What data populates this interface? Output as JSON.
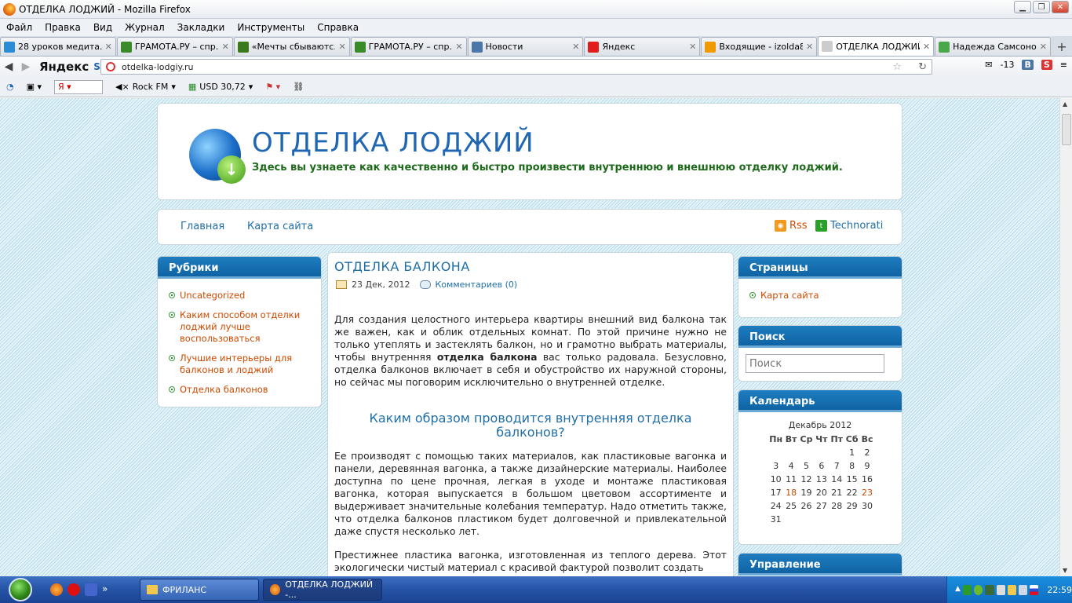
{
  "window": {
    "title": "ОТДЕЛКА ЛОДЖИЙ - Mozilla Firefox"
  },
  "menu": [
    "Файл",
    "Правка",
    "Вид",
    "Журнал",
    "Закладки",
    "Инструменты",
    "Справка"
  ],
  "tabs": [
    {
      "label": "28 уроков медита...",
      "icon": "yandex-icon",
      "color": "#2a8bd6"
    },
    {
      "label": "ГРАМОТА.РУ – спр...",
      "icon": "gramota-icon",
      "color": "#3a8a2a"
    },
    {
      "label": "«Мечты сбываютс...",
      "icon": "game-icon",
      "color": "#3a7a1a"
    },
    {
      "label": "ГРАМОТА.РУ – спр...",
      "icon": "gramota-icon",
      "color": "#3a8a2a"
    },
    {
      "label": "Новости",
      "icon": "vk-icon",
      "color": "#4a76a8"
    },
    {
      "label": "Яндекс",
      "icon": "yandex-icon",
      "color": "#e21b1b"
    },
    {
      "label": "Входящие - izolda8...",
      "icon": "mail-icon",
      "color": "#f09a00"
    },
    {
      "label": "ОТДЕЛКА ЛОДЖИЙ",
      "icon": "page-icon",
      "color": "#cccccc",
      "active": true
    },
    {
      "label": "Надежда Самсоно...",
      "icon": "leaf-icon",
      "color": "#4aa84a"
    }
  ],
  "nav": {
    "url": "otdelka-lodgiy.ru",
    "yandex": "Яндекс",
    "weather": "-13"
  },
  "toolbar": {
    "yandex_search": "Я",
    "radio": "Rock FM",
    "currency": "USD 30,72"
  },
  "site": {
    "title": "ОТДЕЛКА ЛОДЖИЙ",
    "description": "Здесь вы узнаете как качественно и быстро произвести внутреннюю и внешнюю отделку лоджий.",
    "nav": [
      "Главная",
      "Карта сайта"
    ],
    "feeds": [
      "Rss",
      "Technorati"
    ]
  },
  "rubrics": {
    "title": "Рубрики",
    "items": [
      "Uncategorized",
      "Каким способом отделки лоджий лучше воспользоваться",
      "Лучшие интерьеры для балконов и лоджий",
      "Отделка балконов"
    ]
  },
  "post": {
    "title": "ОТДЕЛКА БАЛКОНА",
    "date": "23 Дек, 2012",
    "comments": "Комментариев (0)",
    "p1_a": "Для создания целостного интерьера квартиры внешний вид балкона так же важен, как и облик отдельных комнат. По этой причине нужно не только утеплять и застеклять балкон, но и грамотно выбрать материалы, чтобы внутренняя ",
    "p1_b": "отделка балкона",
    "p1_c": " вас только радовала. Безусловно, отделка балконов включает в себя и обустройство их наружной стороны, но сейчас мы поговорим исключительно о внутренней отделке.",
    "heading": "Каким образом проводится внутренняя отделка балконов?",
    "p2": "Ее производят с помощью таких материалов, как пластиковые вагонка и панели, деревянная вагонка, а также дизайнерские материалы. Наиболее доступна по цене прочная, легкая в уходе и монтаже пластиковая вагонка, которая выпускается в большом цветовом ассортименте и выдерживает значительные колебания температур. Надо отметить также, что отделка балконов пластиком будет долговечной и привлекательной даже спустя несколько лет.",
    "p3": "Престижнее пластика вагонка, изготовленная из теплого дерева. Этот экологически чистый материал с красивой фактурой позволит создать"
  },
  "pages": {
    "title": "Страницы",
    "items": [
      "Карта сайта"
    ]
  },
  "search": {
    "title": "Поиск",
    "placeholder": "Поиск"
  },
  "calendar": {
    "title": "Календарь",
    "caption": "Декабрь 2012",
    "days": [
      "Пн",
      "Вт",
      "Ср",
      "Чт",
      "Пт",
      "Сб",
      "Вс"
    ],
    "weeks": [
      [
        "",
        "",
        "",
        "",
        "",
        "1",
        "2"
      ],
      [
        "3",
        "4",
        "5",
        "6",
        "7",
        "8",
        "9"
      ],
      [
        "10",
        "11",
        "12",
        "13",
        "14",
        "15",
        "16"
      ],
      [
        "17",
        "18",
        "19",
        "20",
        "21",
        "22",
        "23"
      ],
      [
        "24",
        "25",
        "26",
        "27",
        "28",
        "29",
        "30"
      ],
      [
        "31",
        "",
        "",
        "",
        "",
        "",
        ""
      ]
    ],
    "linked": [
      "18",
      "23"
    ]
  },
  "manage": {
    "title": "Управление"
  },
  "taskbar": {
    "buttons": [
      "ФРИЛАНС",
      "ОТДЕЛКА ЛОДЖИЙ -..."
    ],
    "clock": "22:59"
  }
}
